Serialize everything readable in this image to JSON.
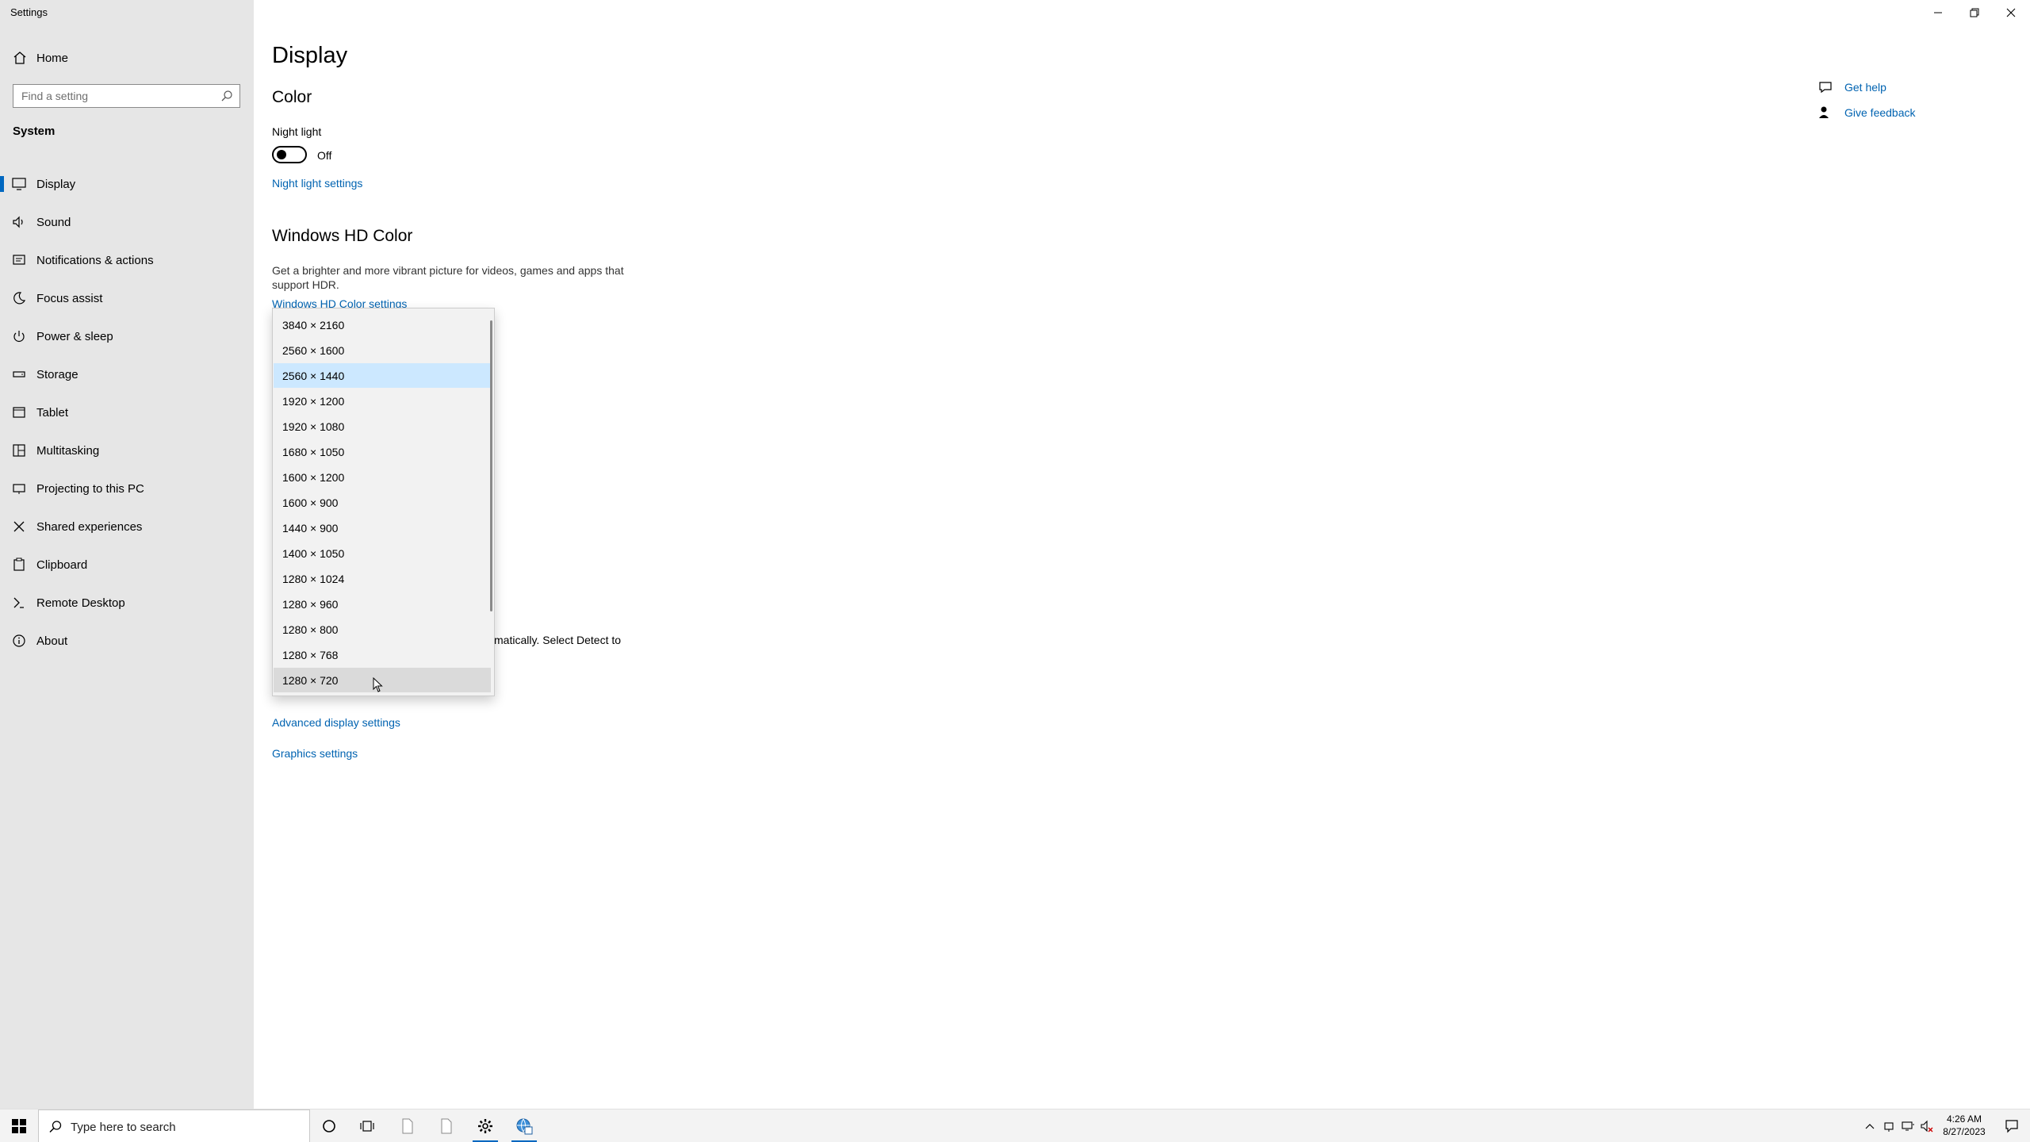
{
  "window": {
    "title": "Settings"
  },
  "sidebar": {
    "home_label": "Home",
    "search_placeholder": "Find a setting",
    "section_title": "System",
    "items": [
      {
        "label": "Display",
        "icon": "monitor-icon",
        "active": true
      },
      {
        "label": "Sound",
        "icon": "speaker-icon"
      },
      {
        "label": "Notifications & actions",
        "icon": "notification-icon"
      },
      {
        "label": "Focus assist",
        "icon": "moon-icon"
      },
      {
        "label": "Power & sleep",
        "icon": "power-icon"
      },
      {
        "label": "Storage",
        "icon": "storage-icon"
      },
      {
        "label": "Tablet",
        "icon": "tablet-icon"
      },
      {
        "label": "Multitasking",
        "icon": "multitasking-icon"
      },
      {
        "label": "Projecting to this PC",
        "icon": "projector-icon"
      },
      {
        "label": "Shared experiences",
        "icon": "shared-icon"
      },
      {
        "label": "Clipboard",
        "icon": "clipboard-icon"
      },
      {
        "label": "Remote Desktop",
        "icon": "remote-desktop-icon"
      },
      {
        "label": "About",
        "icon": "info-icon"
      }
    ]
  },
  "main": {
    "page_title": "Display",
    "color_heading": "Color",
    "night_light_label": "Night light",
    "night_light_state": "Off",
    "night_light_settings_link": "Night light settings",
    "hd_color_heading": "Windows HD Color",
    "hd_color_description": "Get a brighter and more vibrant picture for videos, games and apps that support HDR.",
    "hd_color_settings_link": "Windows HD Color settings",
    "detect_text_fragment": "matically. Select Detect to",
    "advanced_display_link": "Advanced display settings",
    "graphics_settings_link": "Graphics settings"
  },
  "help": {
    "get_help": "Get help",
    "give_feedback": "Give feedback"
  },
  "resolution_dropdown": {
    "selected": "2560 × 1440",
    "hovered": "1280 × 720",
    "options": [
      "3840 × 2160",
      "2560 × 1600",
      "2560 × 1440",
      "1920 × 1200",
      "1920 × 1080",
      "1680 × 1050",
      "1600 × 1200",
      "1600 × 900",
      "1440 × 900",
      "1400 × 1050",
      "1280 × 1024",
      "1280 × 960",
      "1280 × 800",
      "1280 × 768",
      "1280 × 720"
    ]
  },
  "taskbar": {
    "search_placeholder": "Type here to search",
    "time": "4:26 AM",
    "date": "8/27/2023"
  },
  "colors": {
    "accent": "#0067c0",
    "link": "#0063b1",
    "sidebar_bg": "#e6e6e6",
    "selected_bg": "#cce8ff"
  }
}
